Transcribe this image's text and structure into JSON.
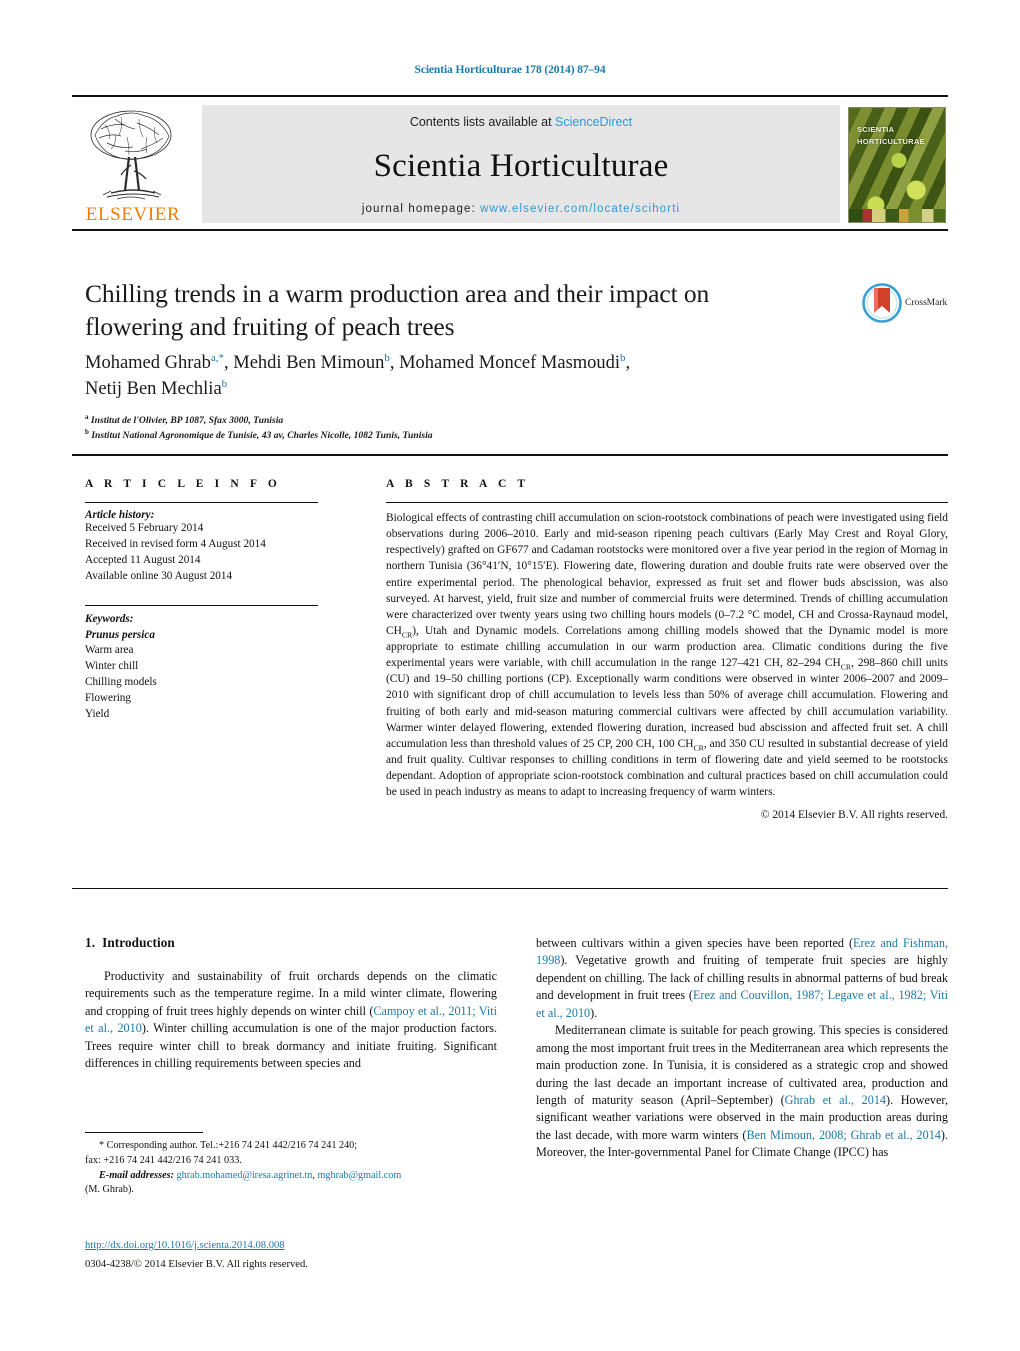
{
  "running_head": "Scientia Horticulturae 178 (2014) 87–94",
  "masthead": {
    "publisher": "ELSEVIER",
    "contents_prefix": "Contents lists available at ",
    "contents_link": "ScienceDirect",
    "journal_title": "Scientia Horticulturae",
    "homepage_prefix": "journal homepage: ",
    "homepage_url": "www.elsevier.com/locate/scihorti",
    "cover_line1": "SCIENTIA",
    "cover_line2": "HORTICULTURAE"
  },
  "article": {
    "title": "Chilling trends in a warm production area and their impact on flowering and fruiting of peach trees",
    "authors_line1_a": "Mohamed Ghrab",
    "authors_sup1": "a,*",
    "authors_line1_b": ", Mehdi Ben Mimoun",
    "authors_sup2": "b",
    "authors_line1_c": ", Mohamed Moncef Masmoudi",
    "authors_sup3": "b",
    "authors_line1_d": ",",
    "authors_line2": "Netij Ben Mechlia",
    "authors_sup4": "b",
    "affiliation_a_sup": "a",
    "affiliation_a": "Institut de l'Olivier, BP 1087, Sfax 3000, Tunisia",
    "affiliation_b_sup": "b",
    "affiliation_b": "Institut National Agronomique de Tunisie, 43 av, Charles Nicolle, 1082 Tunis, Tunisia",
    "crossmark_label": "CrossMark"
  },
  "article_info": {
    "heading": "A R T I C L E   I N F O",
    "history_label": "Article history:",
    "history": [
      "Received 5 February 2014",
      "Received in revised form 4 August 2014",
      "Accepted 11 August 2014",
      "Available online 30 August 2014"
    ],
    "keywords_label": "Keywords:",
    "keywords": [
      "Prunus persica",
      "Warm area",
      "Winter chill",
      "Chilling models",
      "Flowering",
      "Yield"
    ]
  },
  "abstract": {
    "heading": "A B S T R A C T",
    "text_part1": "Biological effects of contrasting chill accumulation on scion-rootstock combinations of peach were investigated using field observations during 2006–2010. Early and mid-season ripening peach cultivars (Early May Crest and Royal Glory, respectively) grafted on GF677 and Cadaman rootstocks were monitored over a five year period in the region of Mornag in northern Tunisia (36°41′N, 10°15′E). Flowering date, flowering duration and double fruits rate were observed over the entire experimental period. The phenological behavior, expressed as fruit set and flower buds abscission, was also surveyed. At harvest, yield, fruit size and number of commercial fruits were determined. Trends of chilling accumulation were characterized over twenty years using two chilling hours models (0–7.2 °C model, CH and Crossa-Raynaud model, CH",
    "sub1": "CR",
    "text_part2": "), Utah and Dynamic models. Correlations among chilling models showed that the Dynamic model is more appropriate to estimate chilling accumulation in our warm production area. Climatic conditions during the five experimental years were variable, with chill accumulation in the range 127–421 CH, 82–294 CH",
    "sub2": "CR",
    "text_part3": ", 298–860 chill units (CU) and 19–50 chilling portions (CP). Exceptionally warm conditions were observed in winter 2006–2007 and 2009–2010 with significant drop of chill accumulation to levels less than 50% of average chill accumulation. Flowering and fruiting of both early and mid-season maturing commercial cultivars were affected by chill accumulation variability. Warmer winter delayed flowering, extended flowering duration, increased bud abscission and affected fruit set. A chill accumulation less than threshold values of 25 CP, 200 CH, 100 CH",
    "sub3": "CR",
    "text_part4": ", and 350 CU resulted in substantial decrease of yield and fruit quality. Cultivar responses to chilling conditions in term of flowering date and yield seemed to be rootstocks dependant. Adoption of appropriate scion-rootstock combination and cultural practices based on chill accumulation could be used in peach industry as means to adapt to increasing frequency of warm winters.",
    "copyright": "© 2014 Elsevier B.V. All rights reserved."
  },
  "introduction": {
    "number": "1.",
    "heading": "Introduction",
    "left_para1_pre": "Productivity and sustainability of fruit orchards depends on the climatic requirements such as the temperature regime. In a mild winter climate, flowering and cropping of fruit trees highly depends on winter chill (",
    "left_cite1": "Campoy et al., 2011; Viti et al., 2010",
    "left_para1_post": "). Winter chilling accumulation is one of the major production factors. Trees require winter chill to break dormancy and initiate fruiting. Significant differences in chilling requirements between species and",
    "right_para1_pre": "between cultivars within a given species have been reported (",
    "right_cite1": "Erez and Fishman, 1998",
    "right_para1_mid": "). Vegetative growth and fruiting of temperate fruit species are highly dependent on chilling. The lack of chilling results in abnormal patterns of bud break and development in fruit trees (",
    "right_cite2": "Erez and Couvillon, 1987; Legave et al., 1982; Viti et al., 2010",
    "right_para1_post": ").",
    "right_para2_pre": "Mediterranean climate is suitable for peach growing. This species is considered among the most important fruit trees in the Mediterranean area which represents the main production zone. In Tunisia, it is considered as a strategic crop and showed during the last decade an important increase of cultivated area, production and length of maturity season (April–September) (",
    "right_cite3": "Ghrab et al., 2014",
    "right_para2_mid": "). However, significant weather variations were observed in the main production areas during the last decade, with more warm winters (",
    "right_cite4": "Ben Mimoun, 2008; Ghrab et al., 2014",
    "right_para2_post": "). Moreover, the Inter-governmental Panel for Climate Change (IPCC) has"
  },
  "footnotes": {
    "corresponding_star": "*",
    "corresponding": "Corresponding author. Tel.:+216 74 241 442/216 74 241 240;",
    "fax": "fax: +216 74 241 442/216 74 241 033.",
    "email_label": "E-mail addresses:",
    "email1": "ghrab.mohamed@iresa.agrinet.tn",
    "email_sep": ", ",
    "email2": "mghrab@gmail.com",
    "email_author": "(M. Ghrab).",
    "doi": "http://dx.doi.org/10.1016/j.scienta.2014.08.008",
    "issn": "0304-4238/© 2014 Elsevier B.V. All rights reserved."
  },
  "colors": {
    "link": "#1a7aa8",
    "science_direct": "#2c9ad6",
    "elsevier_orange": "#ef7d00",
    "mast_bg": "#e6e6e6"
  }
}
